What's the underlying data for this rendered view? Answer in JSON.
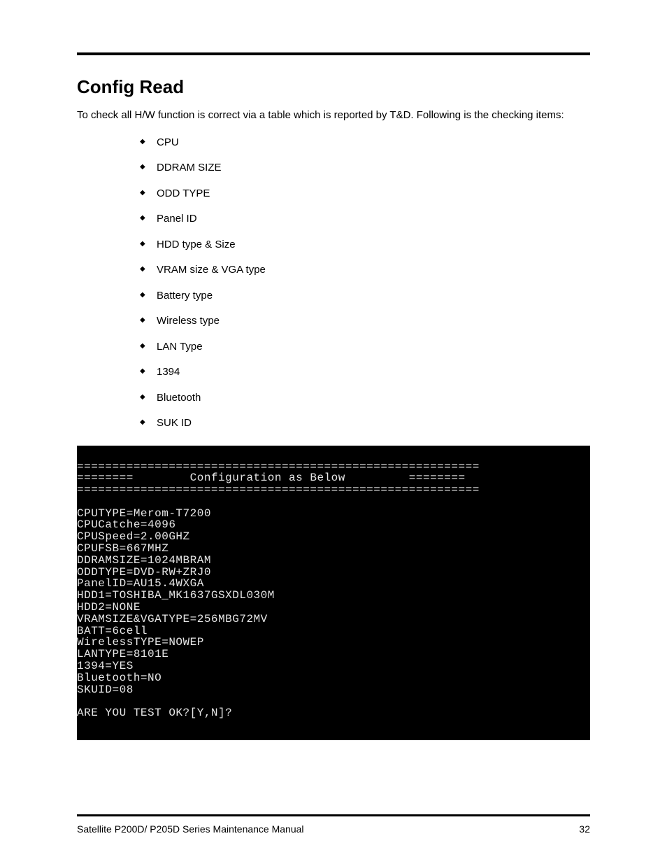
{
  "heading": "Config Read",
  "intro": "To check all H/W function is correct via a table which is reported by T&D. Following is the checking items:",
  "bullets": [
    "CPU",
    "DDRAM SIZE",
    "ODD TYPE",
    "Panel ID",
    "HDD type & Size",
    "VRAM size & VGA type",
    "Battery type",
    "Wireless type",
    "LAN Type",
    "1394",
    "Bluetooth",
    "SUK ID"
  ],
  "terminal": {
    "header_rule": "=========================================================",
    "header_line": "========        Configuration as Below         ========",
    "lines": [
      "CPUTYPE=Merom-T7200",
      "CPUCatche=4096",
      "CPUSpeed=2.00GHZ",
      "CPUFSB=667MHZ",
      "DDRAMSIZE=1024MBRAM",
      "ODDTYPE=DVD-RW+ZRJ0",
      "PanelID=AU15.4WXGA",
      "HDD1=TOSHIBA_MK1637GSXDL030M",
      "HDD2=NONE",
      "VRAMSIZE&VGATYPE=256MBG72MV",
      "BATT=6cell",
      "WirelessTYPE=NOWEP",
      "LANTYPE=8101E",
      "1394=YES",
      "Bluetooth=NO",
      "SKUID=08"
    ],
    "prompt": "ARE YOU TEST OK?[Y,N]?"
  },
  "footer": {
    "left": "Satellite P200D/ P205D Series Maintenance Manual",
    "right": "32"
  }
}
